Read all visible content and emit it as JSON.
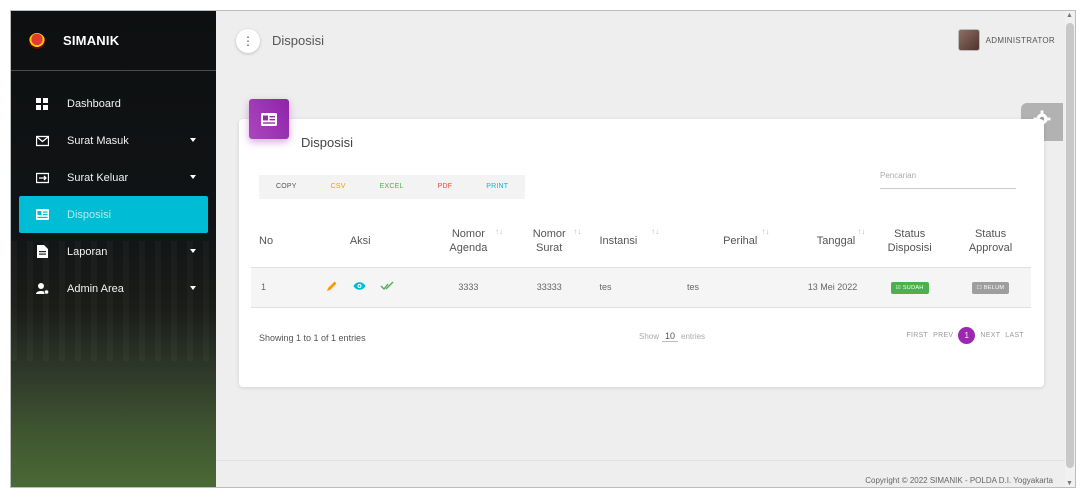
{
  "app": {
    "name": "SIMANIK"
  },
  "sidebar": {
    "items": [
      {
        "label": "Dashboard",
        "icon": "dashboard-icon"
      },
      {
        "label": "Surat Masuk",
        "icon": "mail-in-icon"
      },
      {
        "label": "Surat Keluar",
        "icon": "mail-out-icon"
      },
      {
        "label": "Disposisi",
        "icon": "card-icon"
      },
      {
        "label": "Laporan",
        "icon": "report-icon"
      },
      {
        "label": "Admin Area",
        "icon": "admin-icon"
      }
    ]
  },
  "header": {
    "page_title": "Disposisi",
    "user_name": "ADMINISTRATOR",
    "menu_glyph": "⋮"
  },
  "card": {
    "title": "Disposisi",
    "buttons": [
      {
        "label": "COPY",
        "color": "#555555"
      },
      {
        "label": "CSV",
        "color": "#ff9800"
      },
      {
        "label": "EXCEL",
        "color": "#4caf50"
      },
      {
        "label": "PDF",
        "color": "#f44336"
      },
      {
        "label": "PRINT",
        "color": "#00bcd4"
      }
    ],
    "search_placeholder": "Pencarian",
    "table": {
      "headers": {
        "no": "No",
        "aksi": "Aksi",
        "nomor_agenda_1": "Nomor",
        "nomor_agenda_2": "Agenda",
        "nomor_surat_1": "Nomor",
        "nomor_surat_2": "Surat",
        "instansi": "Instansi",
        "perihal": "Perihal",
        "tanggal": "Tanggal",
        "status_disposisi_1": "Status",
        "status_disposisi_2": "Disposisi",
        "status_approval_1": "Status",
        "status_approval_2": "Approval"
      },
      "rows": [
        {
          "no": "1",
          "nomor_agenda": "3333",
          "nomor_surat": "33333",
          "instansi": "tes",
          "perihal": "tes",
          "tanggal": "13 Mei 2022",
          "status_disposisi": "☑ SUDAH",
          "status_approval": "☐ BELUM"
        }
      ]
    },
    "footer": {
      "showing": "Showing 1 to 1 of 1 entries",
      "show_label": "Show",
      "show_value": "10",
      "entries_label": "entries",
      "first": "FIRST",
      "prev": "PREV",
      "current": "1",
      "next": "NEXT",
      "last": "LAST"
    }
  },
  "copyright": "Copyright © 2022 SIMANIK - POLDA D.I. Yogyakarta",
  "colors": {
    "accent": "#9c27b0",
    "active_nav": "#00bcd4",
    "success": "#4caf50",
    "muted": "#9e9e9e"
  }
}
